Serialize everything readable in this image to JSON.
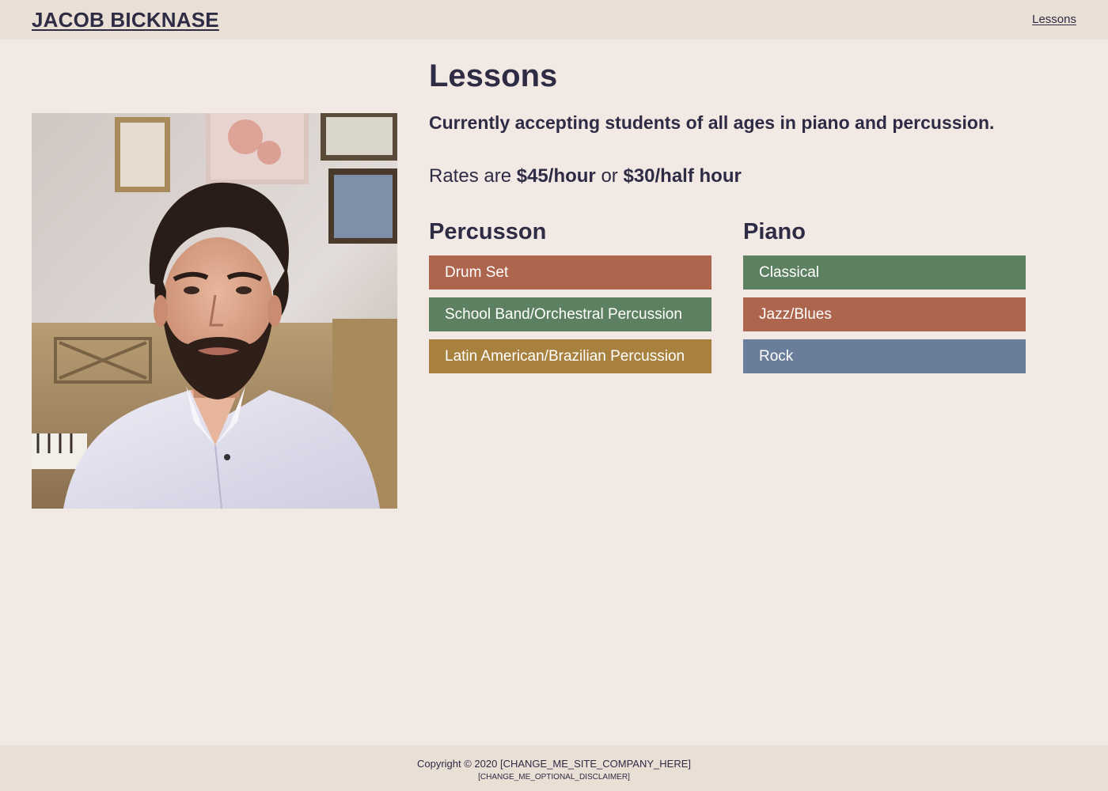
{
  "header": {
    "site_title": "JACOB BICKNASE",
    "nav": [
      {
        "label": "Lessons"
      }
    ]
  },
  "main": {
    "title": "Lessons",
    "subtitle": "Currently accepting students of all ages in piano and percussion.",
    "rates": {
      "prefix": "Rates are",
      "rate_hour": "$45/hour",
      "connector": "or",
      "rate_half_hour": "$30/half hour"
    },
    "columns": [
      {
        "title": "Percusson",
        "items": [
          {
            "label": "Drum Set",
            "color": "#ae654e"
          },
          {
            "label": "School Band/Orchestral Percussion",
            "color": "#5d8160"
          },
          {
            "label": "Latin American/Brazilian Percussion",
            "color": "#a8813e"
          }
        ]
      },
      {
        "title": "Piano",
        "items": [
          {
            "label": "Classical",
            "color": "#5d8160"
          },
          {
            "label": "Jazz/Blues",
            "color": "#ae654e"
          },
          {
            "label": "Rock",
            "color": "#6a7e9b"
          }
        ]
      }
    ]
  },
  "footer": {
    "copyright": "Copyright © 2020 [CHANGE_ME_SITE_COMPANY_HERE]",
    "disclaimer": "[CHANGE_ME_OPTIONAL_DISCLAIMER]"
  },
  "colors": {
    "page_bg": "#f3e9e4",
    "bar_bg": "#e9dfd5",
    "text": "#2e2b45"
  }
}
